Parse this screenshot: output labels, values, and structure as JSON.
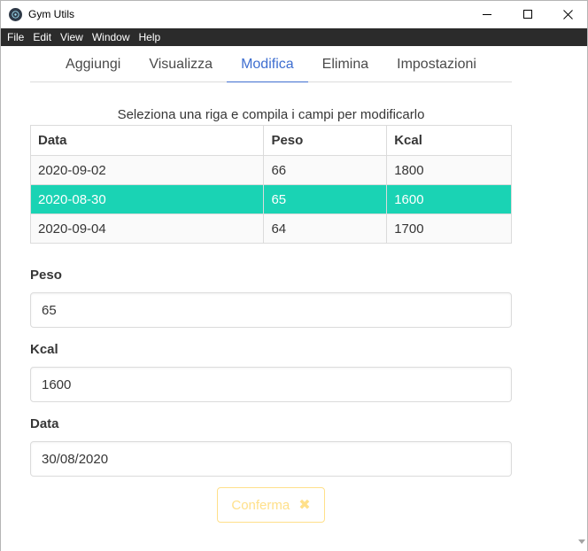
{
  "window": {
    "title": "Gym Utils"
  },
  "menu": [
    "File",
    "Edit",
    "View",
    "Window",
    "Help"
  ],
  "tabs": [
    {
      "label": "Aggiungi",
      "active": false
    },
    {
      "label": "Visualizza",
      "active": false
    },
    {
      "label": "Modifica",
      "active": true
    },
    {
      "label": "Elimina",
      "active": false
    },
    {
      "label": "Impostazioni",
      "active": false
    }
  ],
  "instruction": "Seleziona una riga e compila i campi per modificarlo",
  "table": {
    "headers": [
      "Data",
      "Peso",
      "Kcal"
    ],
    "rows": [
      {
        "data": "2020-09-02",
        "peso": "66",
        "kcal": "1800",
        "selected": false
      },
      {
        "data": "2020-08-30",
        "peso": "65",
        "kcal": "1600",
        "selected": true
      },
      {
        "data": "2020-09-04",
        "peso": "64",
        "kcal": "1700",
        "selected": false
      }
    ]
  },
  "form": {
    "peso": {
      "label": "Peso",
      "value": "65"
    },
    "kcal": {
      "label": "Kcal",
      "value": "1600"
    },
    "data": {
      "label": "Data",
      "value": "30/08/2020"
    }
  },
  "confirm": {
    "label": "Conferma",
    "icon": "x-icon"
  },
  "colors": {
    "accent_tab": "#3e6ed0",
    "selected_row": "#1ad3b4",
    "confirm_warning": "#ffe08a",
    "menubar": "#2b2b2b"
  }
}
